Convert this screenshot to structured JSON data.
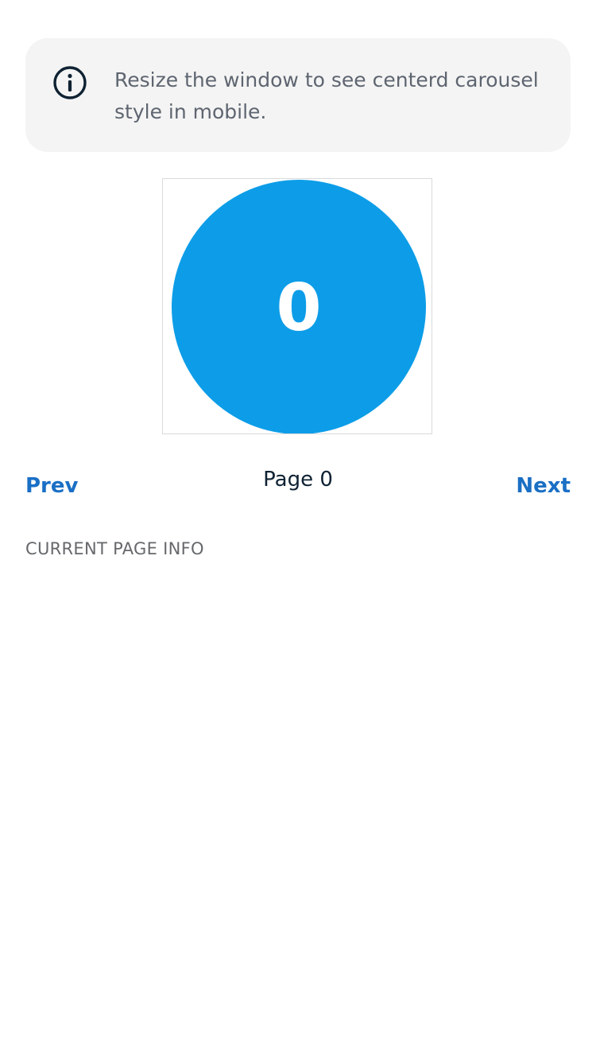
{
  "info_banner": {
    "icon": "info-icon",
    "text": "Resize the window to see centerd carousel style in mobile."
  },
  "carousel": {
    "slide_label": "0",
    "slide_color": "#0d9de8"
  },
  "navigation": {
    "prev_label": "Prev",
    "page_indicator": "Page 0",
    "next_label": "Next",
    "link_color": "#1a6fc5"
  },
  "current_page_info": {
    "heading": "CURRENT PAGE INFO"
  }
}
